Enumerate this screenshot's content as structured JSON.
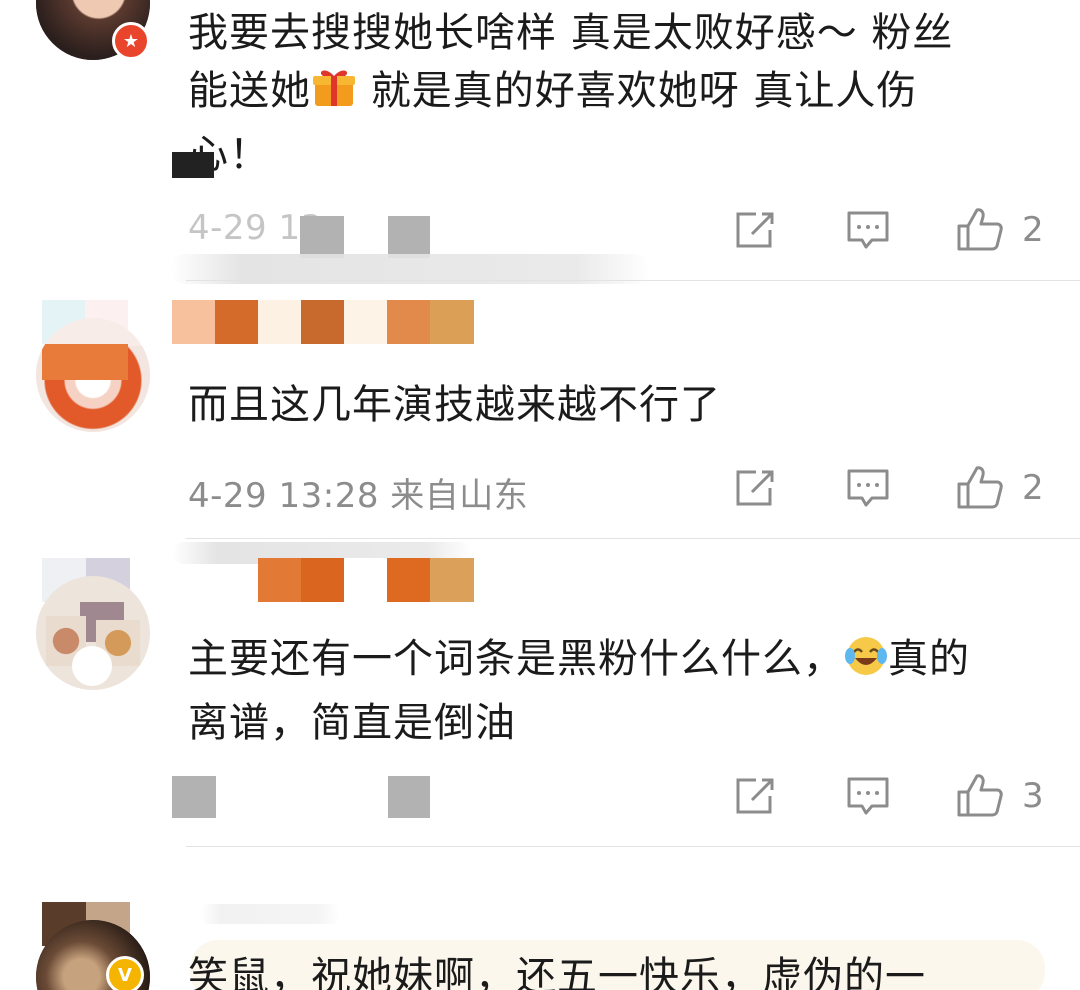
{
  "comments": [
    {
      "text_line1": "我要去搜搜她长啥样 真是太败好感～ 粉丝",
      "text_line2a": "能送她",
      "text_line2b": " 就是真的好喜欢她呀 真让人伤",
      "text_line3": "心！",
      "meta": "4-29 13",
      "likes": "2"
    },
    {
      "text_line1": "而且这几年演技越来越不行了",
      "meta": "4-29 13:28 来自山东",
      "likes": "2"
    },
    {
      "text_line1": "主要还有一个词条是黑粉什么什么，",
      "text_line1b": "真的",
      "text_line2": "离谱，简直是倒油",
      "likes": "3"
    },
    {
      "text_line1": "笑鼠，祝她妹啊，还五一快乐，虚伪的一"
    }
  ],
  "icons": {
    "repost": "repost-icon",
    "comment": "comment-icon",
    "like": "thumbs-up-icon",
    "gift": "gift-emoji",
    "laugh": "laugh-cry-emoji",
    "member_badge": "member-badge-icon",
    "verified_badge": "verified-badge-icon"
  },
  "colors": {
    "text": "#1b1b1b",
    "meta": "#8c8c8c",
    "divider": "#e3e3e3",
    "badge_red": "#e8452c",
    "badge_gold": "#f5b400"
  }
}
